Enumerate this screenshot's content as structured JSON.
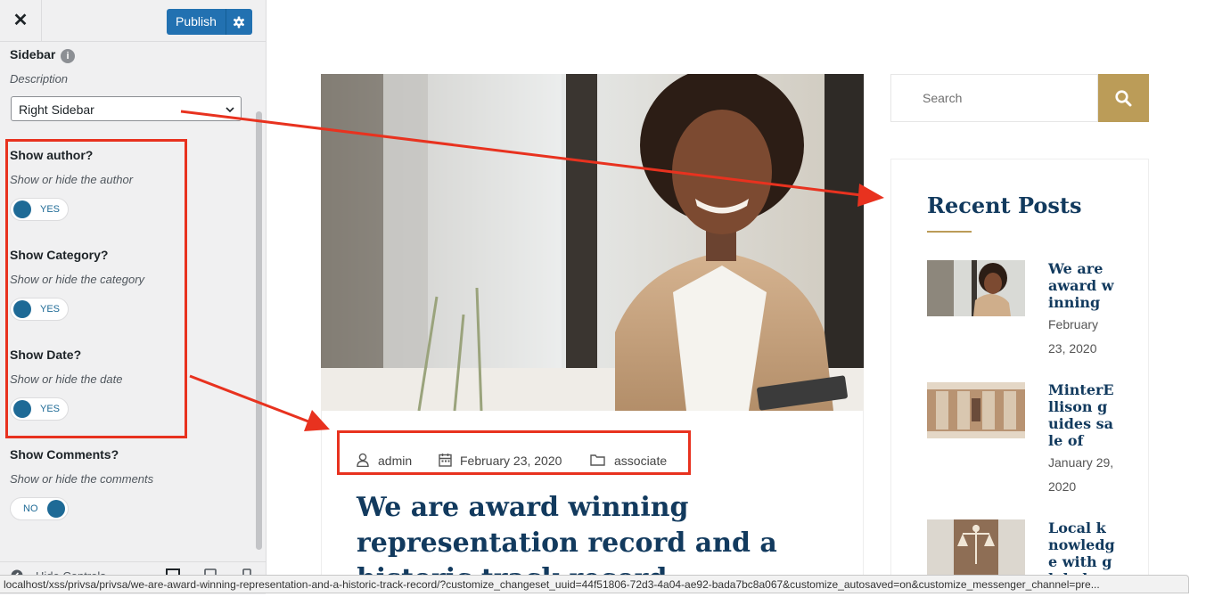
{
  "customizer": {
    "close_label": "✕",
    "publish_label": "Publish",
    "sidebar": {
      "title": "Sidebar",
      "info_glyph": "i",
      "description": "Description",
      "selected_value": "Right Sidebar"
    },
    "show_author": {
      "title": "Show author?",
      "description": "Show or hide the author",
      "state": "YES"
    },
    "show_category": {
      "title": "Show Category?",
      "description": "Show or hide the category",
      "state": "YES"
    },
    "show_date": {
      "title": "Show Date?",
      "description": "Show or hide the date",
      "state": "YES"
    },
    "show_comments": {
      "title": "Show Comments?",
      "description": "Show or hide the comments",
      "state": "NO"
    },
    "footer": {
      "hide_controls_label": "Hide Controls"
    }
  },
  "preview": {
    "post": {
      "author": "admin",
      "date": "February 23, 2020",
      "category": "associate",
      "title": "We are award winning representation record and a historic track record"
    },
    "search": {
      "placeholder": "Search"
    },
    "recent_posts": {
      "title": "Recent Posts",
      "items": [
        {
          "title": "We are award winning",
          "date": "February 23, 2020"
        },
        {
          "title": "MinterEllison guides sale of",
          "date": "January 29, 2020"
        },
        {
          "title": "Local knowledge with global",
          "date": ""
        }
      ]
    }
  },
  "status_bar": {
    "url": "localhost/xss/privsa/privsa/we-are-award-winning-representation-and-a-historic-track-record/?customize_changeset_uuid=44f51806-72d3-4a04-ae92-bada7bc8a067&customize_autosaved=on&customize_messenger_channel=pre..."
  },
  "colors": {
    "wp_blue": "#2271b1",
    "toggle_blue": "#1e6a96",
    "heading_navy": "#123a5e",
    "gold_accent": "#bb9c58",
    "annotation_red": "#e8321f"
  },
  "icons": [
    "close-icon",
    "gear-icon",
    "info-icon",
    "chevron-down-icon",
    "user-icon",
    "calendar-icon",
    "folder-icon",
    "search-icon",
    "preview-desktop-icon",
    "preview-tablet-icon",
    "preview-mobile-icon",
    "collapse-icon"
  ]
}
